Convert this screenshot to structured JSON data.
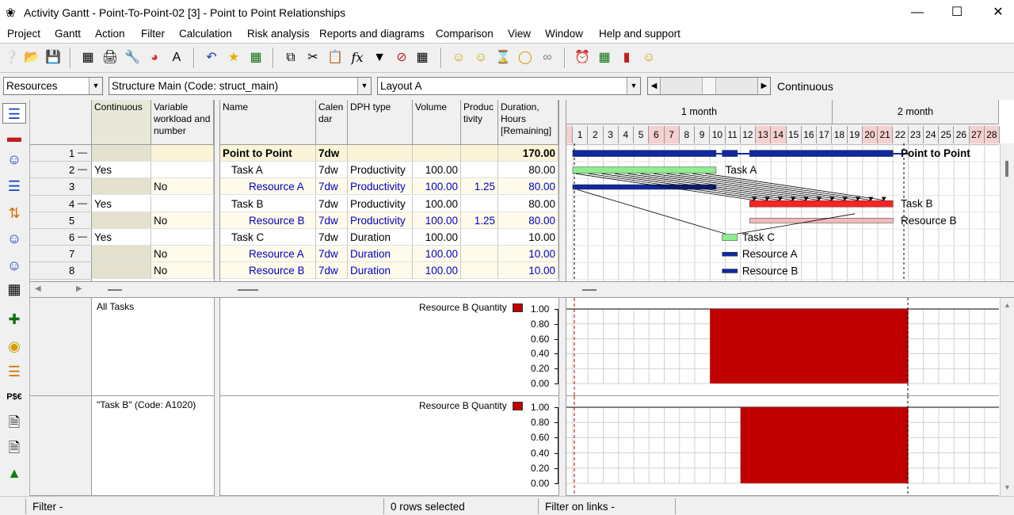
{
  "title": "Activity Gantt - Point-To-Point-02 [3] - Point to Point Relationships",
  "window_buttons": {
    "minimize": "—",
    "maximize": "☐",
    "close": "✕"
  },
  "menu": [
    "Project",
    "Gantt",
    "Action",
    "Filter",
    "Calculation",
    "Risk analysis",
    "Reports and diagrams",
    "Comparison",
    "View",
    "Window",
    "Help and support"
  ],
  "selectors": {
    "view": "Resources",
    "structure": "Structure Main (Code: struct_main)",
    "layout": "Layout A",
    "mode": "Continuous"
  },
  "left_columns": {
    "continuous": "Continuous",
    "variable": "Variable workload and number"
  },
  "columns": {
    "name": "Name",
    "calendar": "Calen dar",
    "dph": "DPH type",
    "volume": "Volume",
    "productivity": "Produc tivity",
    "duration": "Duration, Hours [Remaining]"
  },
  "timescale": {
    "month1": "1 month",
    "month2": "2 month",
    "days": [
      "1",
      "2",
      "3",
      "4",
      "5",
      "6",
      "7",
      "8",
      "9",
      "10",
      "11",
      "12",
      "13",
      "14",
      "15",
      "16",
      "17",
      "18",
      "19",
      "20",
      "21",
      "22",
      "23",
      "24",
      "25",
      "26",
      "27",
      "28"
    ],
    "weekend_days": [
      "6",
      "7",
      "13",
      "14",
      "20",
      "21",
      "27",
      "28"
    ]
  },
  "rows": [
    {
      "num": "1",
      "tree": "—",
      "continuous": "",
      "variable": "",
      "name": "Point to Point",
      "calendar": "7dw",
      "dph": "",
      "volume": "",
      "productivity": "",
      "duration": "170.00",
      "kind": "summary"
    },
    {
      "num": "2",
      "tree": "—",
      "continuous": "Yes",
      "variable": "",
      "name": "Task A",
      "calendar": "7dw",
      "dph": "Productivity",
      "volume": "100.00",
      "productivity": "",
      "duration": "80.00",
      "kind": "task"
    },
    {
      "num": "3",
      "tree": "",
      "continuous": "",
      "variable": "No",
      "name": "Resource A",
      "calendar": "7dw",
      "dph": "Productivity",
      "volume": "100.00",
      "productivity": "1.25",
      "duration": "80.00",
      "kind": "resource"
    },
    {
      "num": "4",
      "tree": "—",
      "continuous": "Yes",
      "variable": "",
      "name": "Task B",
      "calendar": "7dw",
      "dph": "Productivity",
      "volume": "100.00",
      "productivity": "",
      "duration": "80.00",
      "kind": "task"
    },
    {
      "num": "5",
      "tree": "",
      "continuous": "",
      "variable": "No",
      "name": "Resource B",
      "calendar": "7dw",
      "dph": "Productivity",
      "volume": "100.00",
      "productivity": "1.25",
      "duration": "80.00",
      "kind": "resource"
    },
    {
      "num": "6",
      "tree": "—",
      "continuous": "Yes",
      "variable": "",
      "name": "Task C",
      "calendar": "7dw",
      "dph": "Duration",
      "volume": "100.00",
      "productivity": "",
      "duration": "10.00",
      "kind": "task"
    },
    {
      "num": "7",
      "tree": "",
      "continuous": "",
      "variable": "No",
      "name": "Resource A",
      "calendar": "7dw",
      "dph": "Duration",
      "volume": "100.00",
      "productivity": "",
      "duration": "10.00",
      "kind": "resource"
    },
    {
      "num": "8",
      "tree": "",
      "continuous": "",
      "variable": "No",
      "name": "Resource B",
      "calendar": "7dw",
      "dph": "Duration",
      "volume": "100.00",
      "productivity": "",
      "duration": "10.00",
      "kind": "resource"
    }
  ],
  "gantt_labels": [
    "Point to Point",
    "Task A",
    "Task B",
    "Resource B",
    "Task C",
    "Resource A",
    "Resource B"
  ],
  "histograms": [
    {
      "label": "All Tasks",
      "series": "Resource B Quantity",
      "ticks": [
        "1.00",
        "0.80",
        "0.60",
        "0.40",
        "0.20",
        "0.00"
      ],
      "value": 1.0,
      "start_day": 10,
      "end_day": 22,
      "color": "#c00000"
    },
    {
      "label": "\"Task  B\" (Code: A1020)",
      "series": "Resource B Quantity",
      "ticks": [
        "1.00",
        "0.80",
        "0.60",
        "0.40",
        "0.20",
        "0.00"
      ],
      "value": 1.0,
      "start_day": 12,
      "end_day": 22,
      "color": "#c00000"
    }
  ],
  "status": {
    "filter": "Filter -",
    "rows": "0 rows selected",
    "links": "Filter on links -"
  }
}
